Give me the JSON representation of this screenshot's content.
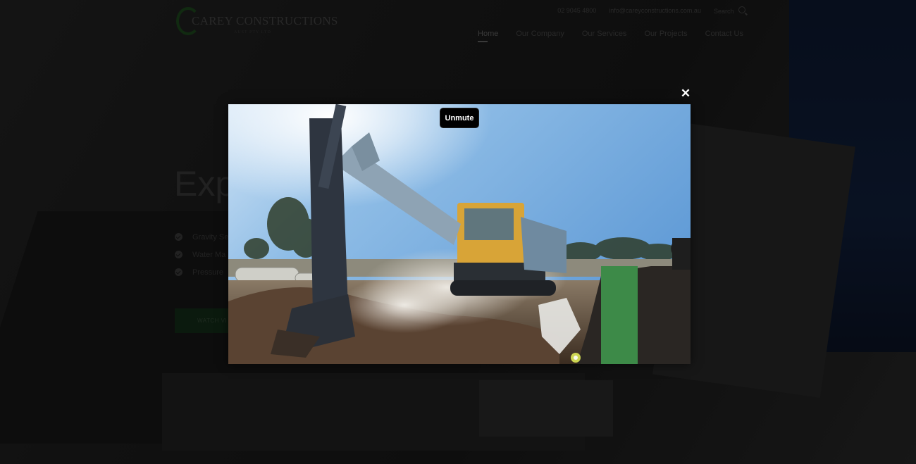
{
  "header": {
    "logo_text": "Carey Constructions",
    "logo_sub": "AUST PTY LTD",
    "phone": "02 9045 4800",
    "email": "info@careyconstructions.com.au",
    "search_label": "Search",
    "nav": [
      {
        "label": "Home",
        "active": true
      },
      {
        "label": "Our Company"
      },
      {
        "label": "Our Services"
      },
      {
        "label": "Our Projects"
      },
      {
        "label": "Contact Us"
      }
    ]
  },
  "hero": {
    "title_visible": "Exp",
    "list": [
      "Gravity Se",
      "Water Ma",
      "Pressure"
    ],
    "button_label": "WATCH VI"
  },
  "modal": {
    "close_glyph": "✕",
    "unmute_label": "Unmute",
    "video_overlay_color": "#3d8a48"
  }
}
